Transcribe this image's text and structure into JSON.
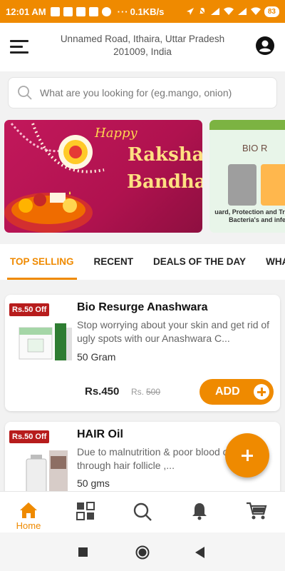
{
  "status_bar": {
    "time": "12:01 AM",
    "network_speed": "0.1KB/s",
    "battery": "83"
  },
  "header": {
    "address_line1": "Unnamed Road, Ithaira, Uttar Pradesh",
    "address_line2": "201009, India"
  },
  "search": {
    "placeholder": "What are you looking for (eg.mango, onion)"
  },
  "banners": [
    {
      "line1": "Happy",
      "line2": "Raksha",
      "line3": "Bandhan"
    },
    {
      "brand": "BIO R",
      "caption": "uard, Protection and Treatm Bacteria's and infe"
    }
  ],
  "tabs": [
    {
      "label": "TOP SELLING",
      "active": true
    },
    {
      "label": "RECENT",
      "active": false
    },
    {
      "label": "DEALS OF THE DAY",
      "active": false
    },
    {
      "label": "WHAT'S N",
      "active": false
    }
  ],
  "products": [
    {
      "offer": "Rs.50 Off",
      "name": "Bio Resurge Anashwara",
      "description": "Stop worrying about your skin and get rid of ugly spots with our Anashwara C...",
      "quantity": "50 Gram",
      "price": "Rs.450",
      "mrp_label": "Rs.",
      "mrp": "500",
      "add_label": "ADD"
    },
    {
      "offer": "Rs.50 Off",
      "name": "HAIR Oil",
      "description": "Due to malnutrition & poor blood circulation through hair follicle ,...",
      "quantity": "50 gms"
    }
  ],
  "bottom_nav": [
    {
      "label": "Home",
      "icon": "home-icon",
      "active": true
    },
    {
      "label": "",
      "icon": "categories-icon",
      "active": false
    },
    {
      "label": "",
      "icon": "search-icon",
      "active": false
    },
    {
      "label": "",
      "icon": "bell-icon",
      "active": false
    },
    {
      "label": "",
      "icon": "cart-icon",
      "active": false
    }
  ],
  "colors": {
    "accent": "#ef8a00",
    "offer_badge": "#b71c1c",
    "banner_pink": "#c2185b"
  }
}
